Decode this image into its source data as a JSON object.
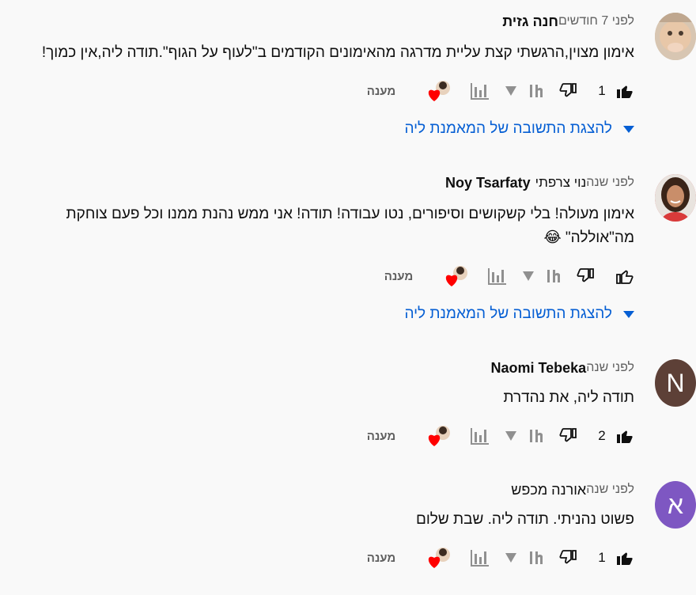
{
  "comments": [
    {
      "author": "חנה גזית",
      "time": "לפני 7 חודשים",
      "text_lines": [
        "אימון מצוין,הרגשתי קצת עליית מדרגה מהאימונים הקודמים ב\"לעוף על הגוף\".תודה ליה,אין כמוך!"
      ],
      "likes": "1",
      "liked": true,
      "reply_label": "מענה",
      "show_replies_label": "להצגת התשובה של המאמנת ליה",
      "avatar_type": "photo-baby"
    },
    {
      "author": "Noy Tsarfaty",
      "author_extra": "נוי צרפתי",
      "time": "לפני שנה",
      "text_lines": [
        "אימון מעולה! בלי קשקושים וסיפורים, נטו עבודה! תודה! אני ממש נהנת ממנו וכל פעם צוחקת",
        "מה\"אוללה\" 😂"
      ],
      "likes": "",
      "liked": false,
      "reply_label": "מענה",
      "show_replies_label": "להצגת התשובה של המאמנת ליה",
      "avatar_type": "photo-woman"
    },
    {
      "author": "Naomi Tebeka",
      "time": "לפני שנה",
      "text_lines": [
        "תודה ליה, את נהדרת"
      ],
      "likes": "2",
      "liked": true,
      "reply_label": "מענה",
      "avatar_type": "letter",
      "avatar_letter": "N",
      "avatar_color": "#5d4037"
    },
    {
      "author": "אורנה מכפש",
      "time": "לפני שנה",
      "text_lines": [
        "פשוט נהניתי. תודה ליה. שבת שלום"
      ],
      "likes": "1",
      "liked": true,
      "reply_label": "מענה",
      "avatar_type": "letter",
      "avatar_letter": "א",
      "avatar_color": "#7e57c2"
    }
  ],
  "icons": {
    "like": "thumbs-up-icon",
    "dislike": "thumbs-down-icon",
    "sort": "sort-icon",
    "analytics": "bar-chart-icon",
    "creator_heart": "creator-heart-icon",
    "expand": "caret-down-icon"
  },
  "colors": {
    "link_blue": "#065fd4",
    "heart_red": "#ff0000",
    "secondary_text": "#606060"
  }
}
